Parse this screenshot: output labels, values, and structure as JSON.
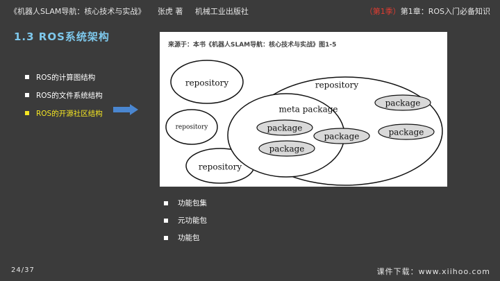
{
  "header": {
    "book": "《机器人SLAM导航：核心技术与实战》",
    "author": "张虎 著",
    "publisher": "机械工业出版社",
    "season": "（第1季）",
    "chapter": "第1章：ROS入门必备知识"
  },
  "section_title": "1.3 ROS系统架构",
  "left_list": [
    {
      "label": "ROS的计算图结构"
    },
    {
      "label": "ROS的文件系统结构"
    },
    {
      "label": "ROS的开源社区结构"
    }
  ],
  "figure": {
    "caption": "来源于：本书《机器人SLAM导航：核心技术与实战》图1-5",
    "labels": {
      "repo_top": "repository",
      "repo_small": "repository",
      "repo_bottom": "repository",
      "repo_big": "repository",
      "meta": "meta package",
      "pkg1": "package",
      "pkg2": "package",
      "pkg3": "package",
      "pkg4": "package",
      "pkg5": "package"
    }
  },
  "right_list": [
    {
      "label": "功能包集"
    },
    {
      "label": "元功能包"
    },
    {
      "label": "功能包"
    }
  ],
  "page": "24/37",
  "footer": "课件下载：www.xiihoo.com",
  "colors": {
    "background": "#3b3b3b",
    "title": "#7ec8ec",
    "highlight": "#f5e623",
    "season": "#e03c31",
    "arrow": "#4a86d0"
  }
}
